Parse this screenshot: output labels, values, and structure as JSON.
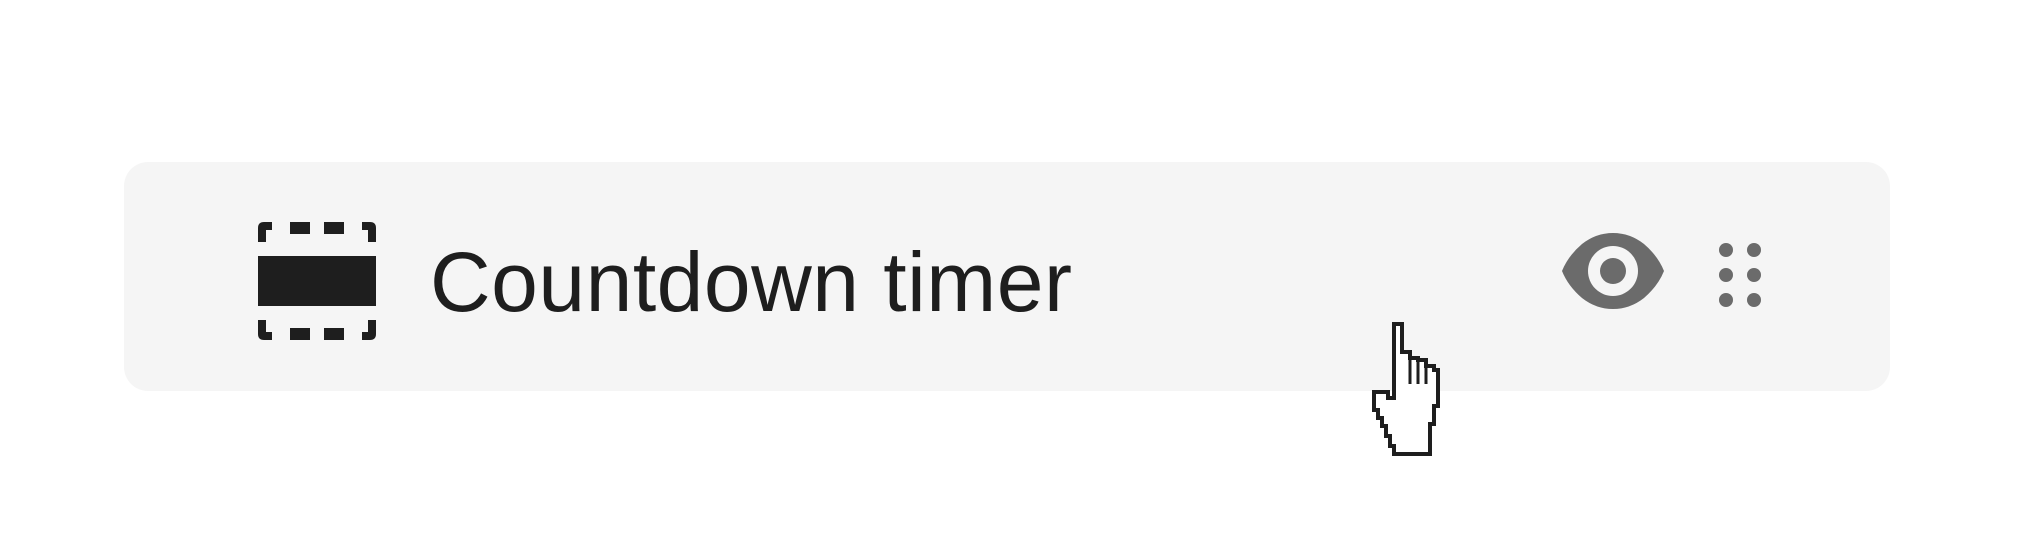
{
  "block": {
    "label": "Countdown timer",
    "icon": "countdown-block-icon",
    "actions": {
      "visibility_icon": "eye-icon",
      "drag_icon": "drag-handle-icon"
    }
  },
  "pointer": {
    "icon": "hand-pointer-cursor-icon"
  },
  "colors": {
    "row_background": "#f5f5f5",
    "text": "#1e1e1e",
    "icon_muted": "#6b6b6b"
  }
}
